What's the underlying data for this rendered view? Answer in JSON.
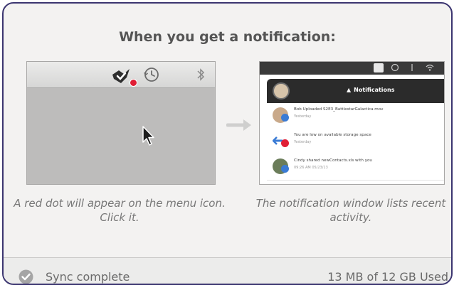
{
  "heading": "When you get a notification:",
  "left_illustration": {
    "icons": [
      "app-icon",
      "red-dot",
      "history-icon",
      "bluetooth-icon",
      "cursor-icon"
    ]
  },
  "right_illustration": {
    "header_title": "Notifications",
    "items": [
      {
        "text": "Bob Uploaded S2E3_BattlestarGalactica.mov",
        "time": "Yesterday",
        "icon": "user-avatar"
      },
      {
        "text": "You are low on available storage space",
        "time": "Yesterday",
        "icon": "storage-warning-icon"
      },
      {
        "text": "Cindy shared newContacts.xls with you",
        "time": "09:26 AM 05/23/13",
        "icon": "user-avatar"
      }
    ]
  },
  "captions": {
    "left": "A red dot will appear on the menu icon. Click it.",
    "right": "The notification window lists recent activity."
  },
  "footer": {
    "status": "Sync complete",
    "usage": "13 MB of 12 GB Used"
  },
  "colors": {
    "border": "#3b3570",
    "alert_dot": "#e01e35",
    "background": "#f3f2f1"
  }
}
